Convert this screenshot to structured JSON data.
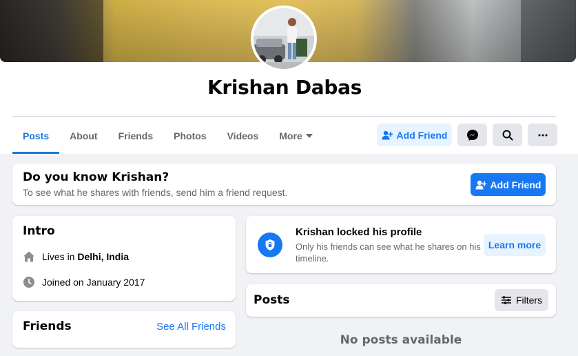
{
  "profile": {
    "name": "Krishan Dabas"
  },
  "tabs": [
    {
      "label": "Posts",
      "active": true
    },
    {
      "label": "About"
    },
    {
      "label": "Friends"
    },
    {
      "label": "Photos"
    },
    {
      "label": "Videos"
    },
    {
      "label": "More"
    }
  ],
  "header_actions": {
    "add_friend_label": "Add Friend",
    "messenger_icon": "messenger-icon",
    "search_icon": "search-icon",
    "more_icon": "more-dots-icon"
  },
  "know_card": {
    "title": "Do you know Krishan?",
    "subtitle": "To see what he shares with friends, send him a friend request.",
    "button_label": "Add Friend"
  },
  "intro": {
    "title": "Intro",
    "lives_prefix": "Lives in",
    "lives_place": "Delhi, India",
    "joined": "Joined on January 2017"
  },
  "friends_card": {
    "title": "Friends",
    "see_all": "See All Friends"
  },
  "locked_card": {
    "title": "Krishan locked his profile",
    "subtitle": "Only his friends can see what he shares on his timeline.",
    "button_label": "Learn more"
  },
  "posts_card": {
    "title": "Posts",
    "filters_label": "Filters",
    "empty_text": "No posts available"
  },
  "colors": {
    "accent": "#1877f2",
    "tab_active": "#1b74e4",
    "secondary_text": "#65676b",
    "page_bg": "#f0f2f5"
  }
}
